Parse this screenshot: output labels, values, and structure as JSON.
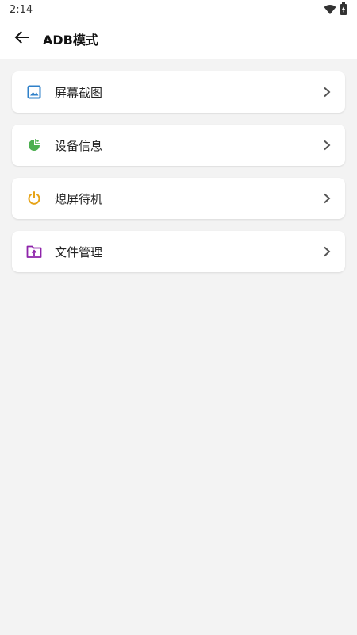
{
  "status_bar": {
    "time": "2:14",
    "icons": [
      "wifi-icon",
      "battery-icon"
    ]
  },
  "app_bar": {
    "back_icon": "arrow-back-icon",
    "title": "ADB模式"
  },
  "menu": {
    "items": [
      {
        "label": "屏幕截图",
        "icon": "image-icon",
        "color": "#2f80c9"
      },
      {
        "label": "设备信息",
        "icon": "device-info-icon",
        "color": "#4caf50"
      },
      {
        "label": "熄屏待机",
        "icon": "power-icon",
        "color": "#e6a317"
      },
      {
        "label": "文件管理",
        "icon": "folder-upload-icon",
        "color": "#8e24aa"
      }
    ],
    "chevron_icon": "chevron-right-icon"
  }
}
